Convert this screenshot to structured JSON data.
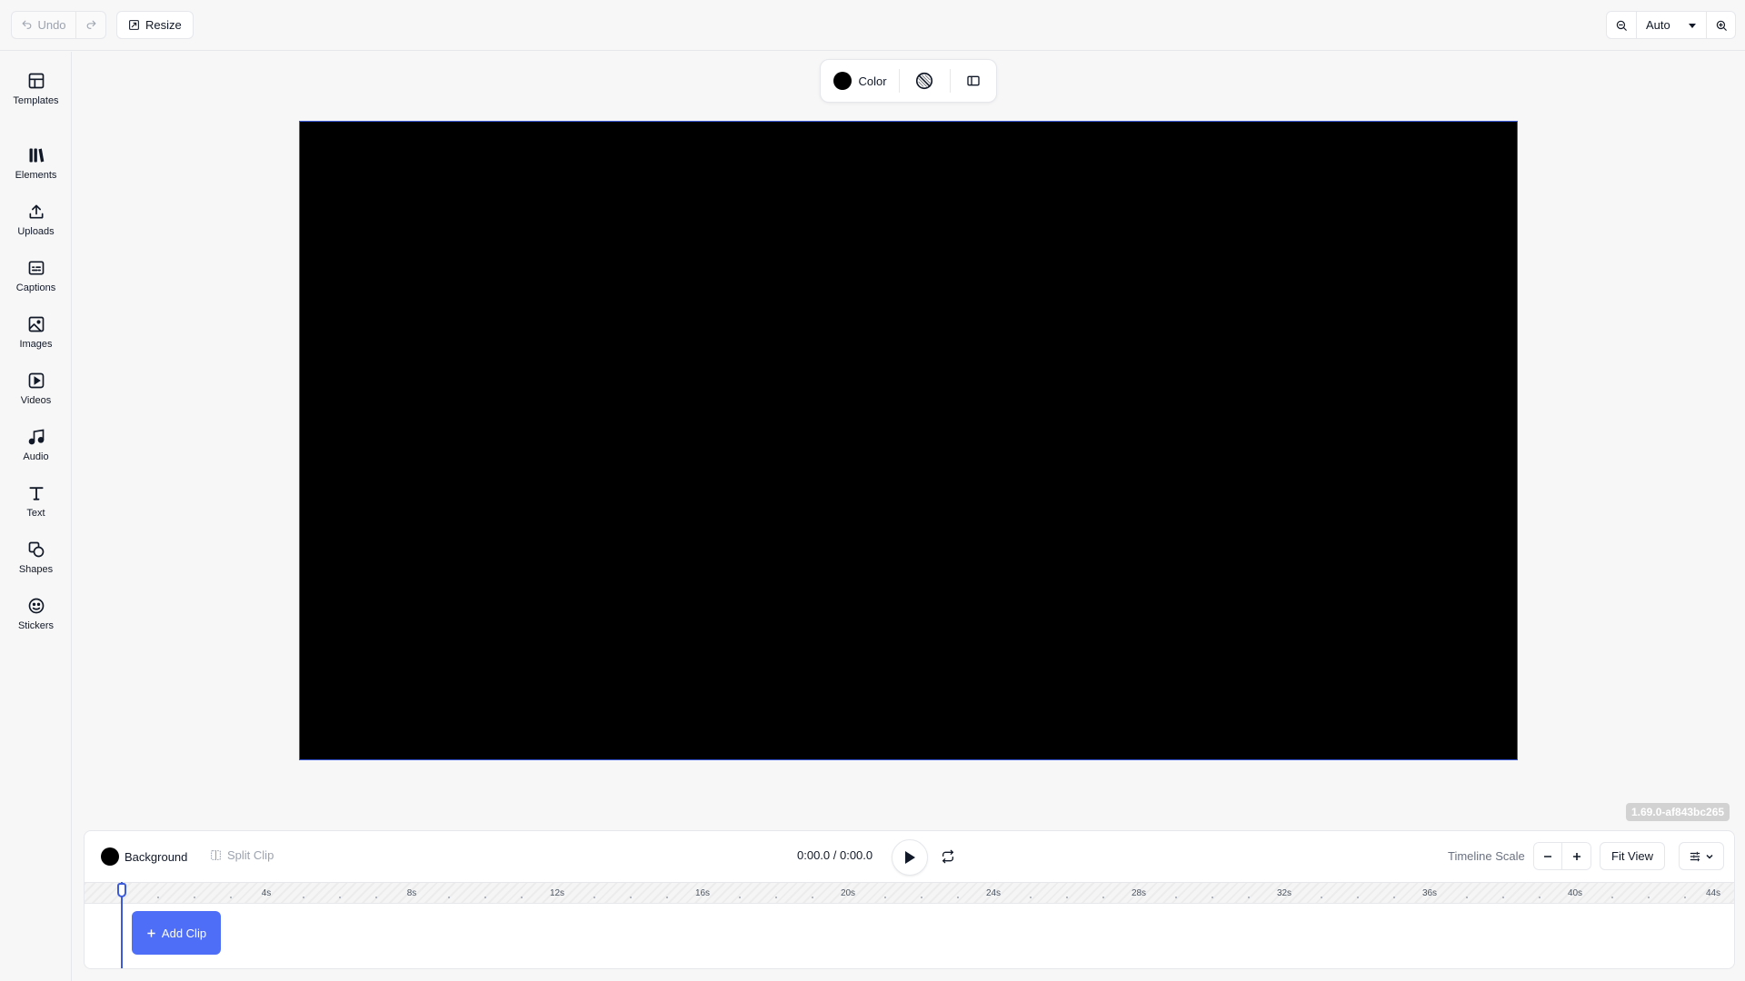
{
  "toolbar": {
    "undo_label": "Undo",
    "redo_icon": "redo-icon",
    "resize_label": "Resize",
    "zoom_value": "Auto"
  },
  "sidebar": {
    "items": [
      {
        "label": "Templates",
        "icon": "templates-icon"
      },
      {
        "label": "Elements",
        "icon": "elements-icon"
      },
      {
        "label": "Uploads",
        "icon": "upload-icon"
      },
      {
        "label": "Captions",
        "icon": "captions-icon"
      },
      {
        "label": "Images",
        "icon": "image-icon"
      },
      {
        "label": "Videos",
        "icon": "video-icon"
      },
      {
        "label": "Audio",
        "icon": "music-icon"
      },
      {
        "label": "Text",
        "icon": "text-icon"
      },
      {
        "label": "Shapes",
        "icon": "shapes-icon"
      },
      {
        "label": "Stickers",
        "icon": "sticker-icon"
      }
    ]
  },
  "canvas_toolbar": {
    "color_label": "Color",
    "color_value": "#000000"
  },
  "canvas": {
    "background": "#000000"
  },
  "version": "1.69.0-af843bc265",
  "timeline": {
    "background_label": "Background",
    "split_label": "Split Clip",
    "time_display": "0:00.0 / 0:00.0",
    "scale_label": "Timeline Scale",
    "fit_label": "Fit View",
    "add_clip_label": "Add Clip",
    "ruler_labels": [
      "4s",
      "8s",
      "12s",
      "16s",
      "20s",
      "24s",
      "28s",
      "32s",
      "36s",
      "40s",
      "44s"
    ]
  },
  "colors": {
    "accent": "#4f6ef7",
    "playhead": "#3b5bdb"
  }
}
